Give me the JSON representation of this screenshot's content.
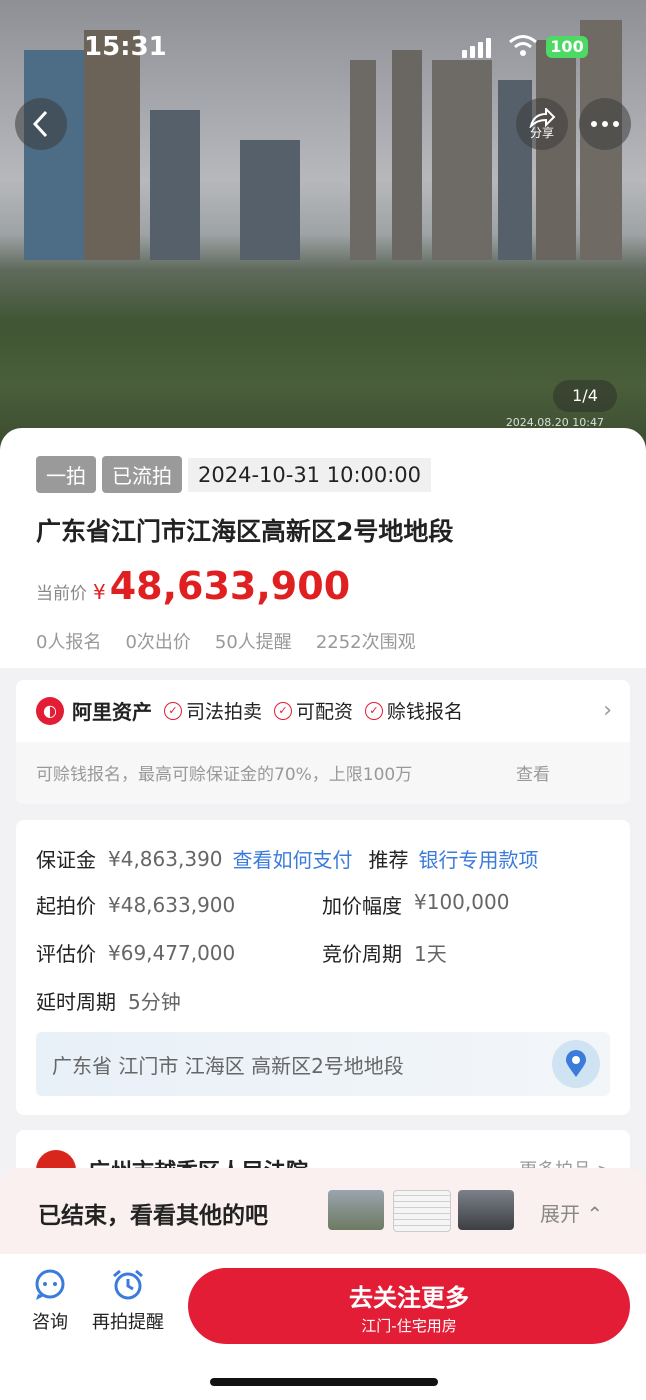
{
  "status_bar": {
    "time": "15:31",
    "battery": "100"
  },
  "hero": {
    "share_label": "分享",
    "pager": "1/4",
    "timestamp": "2024.08.20  10:47"
  },
  "auction": {
    "round_tag": "一拍",
    "status_tag": "已流拍",
    "datetime": "2024-10-31 10:00:00",
    "title": "广东省江门市江海区高新区2号地地段",
    "price_label": "当前价",
    "currency": "¥",
    "price": "48,633,900",
    "stats": [
      "0人报名",
      "0次出价",
      "50人提醒",
      "2252次围观"
    ]
  },
  "ali": {
    "brand": "阿里资产",
    "badges": [
      "司法拍卖",
      "可配资",
      "赊钱报名"
    ],
    "sub_text": "可赊钱报名，最高可赊保证金的70%，上限100万",
    "view_link": "查看"
  },
  "info": {
    "deposit_label": "保证金",
    "deposit_value": "¥4,863,390",
    "deposit_link": "查看如何支付",
    "recommend_label": "推荐",
    "recommend_link": "银行专用款项",
    "start_label": "起拍价",
    "start_value": "¥48,633,900",
    "increment_label": "加价幅度",
    "increment_value": "¥100,000",
    "appraisal_label": "评估价",
    "appraisal_value": "¥69,477,000",
    "cycle_label": "竞价周期",
    "cycle_value": "1天",
    "delay_label": "延时周期",
    "delay_value": "5分钟",
    "address": "广东省 江门市 江海区 高新区2号地地段"
  },
  "court": {
    "name": "广州市越秀区人民法院",
    "more": "更多拍品 >"
  },
  "ended": {
    "text": "已结束，看看其他的吧",
    "expand": "展开"
  },
  "bottom": {
    "consult": "咨询",
    "remind": "再拍提醒",
    "cta_main": "去关注更多",
    "cta_sub": "江门-住宅用房"
  }
}
